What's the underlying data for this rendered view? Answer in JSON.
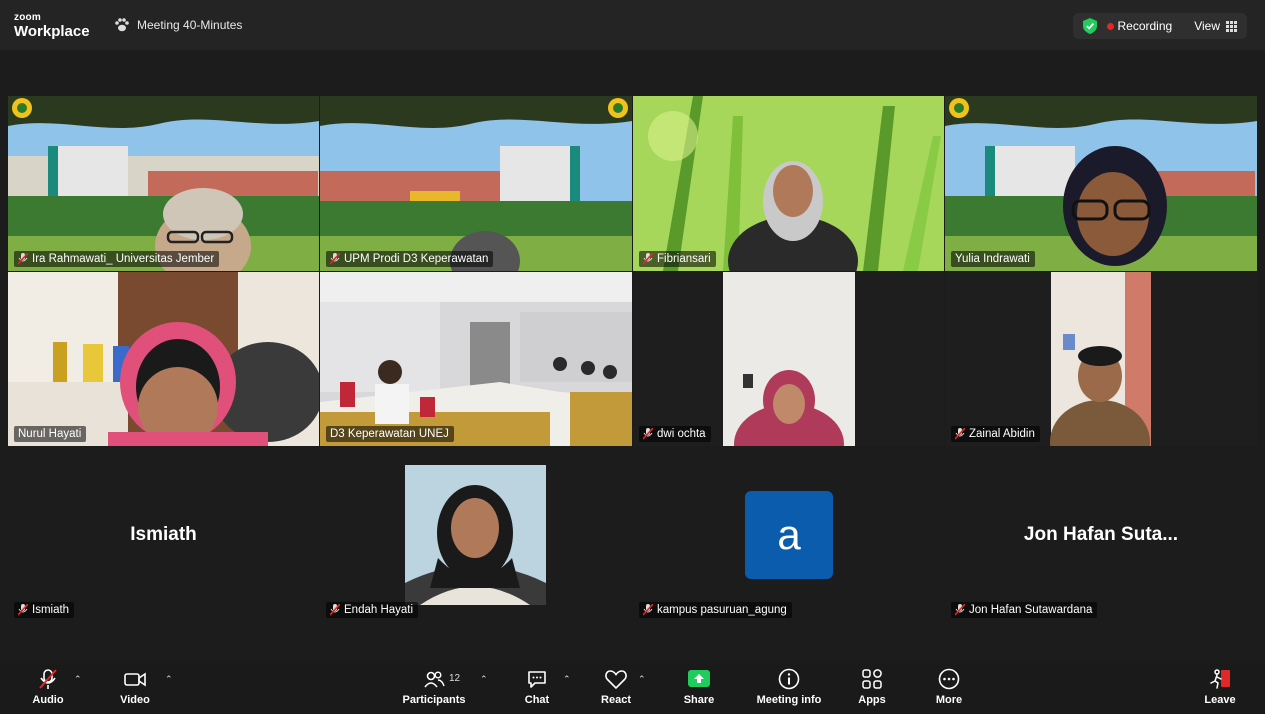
{
  "header": {
    "logo_top": "zoom",
    "logo_bottom": "Workplace",
    "meeting_title": "Meeting 40-Minutes",
    "recording_label": "Recording",
    "view_label": "View"
  },
  "participants": [
    {
      "name": "Ira Rahmawati_ Universitas Jember",
      "muted": true
    },
    {
      "name": "UPM Prodi D3 Keperawatan",
      "muted": true
    },
    {
      "name": "Fibriansari",
      "muted": true
    },
    {
      "name": "Yulia Indrawati",
      "muted": false,
      "active_speaker": true
    },
    {
      "name": "Nurul Hayati",
      "muted": false
    },
    {
      "name": "D3 Keperawatan UNEJ",
      "muted": false
    },
    {
      "name": "dwi ochta",
      "muted": true
    },
    {
      "name": "Zainal Abidin",
      "muted": true
    },
    {
      "name": "Ismiath",
      "muted": true,
      "display_name": "Ismiath"
    },
    {
      "name": "Endah Hayati",
      "muted": true
    },
    {
      "name": "kampus pasuruan_agung",
      "muted": true,
      "avatar_letter": "a"
    },
    {
      "name": "Jon Hafan Sutawardana",
      "muted": true,
      "display_name": "Jon Hafan Suta..."
    }
  ],
  "toolbar": {
    "audio": "Audio",
    "video": "Video",
    "participants": "Participants",
    "participants_count": "12",
    "chat": "Chat",
    "react": "React",
    "share": "Share",
    "meeting_info": "Meeting info",
    "apps": "Apps",
    "more": "More",
    "leave": "Leave"
  },
  "colors": {
    "active_speaker": "#3de07a",
    "share_green": "#1fcc5c",
    "recording_red": "#e02828",
    "avatar_blue": "#0b5cad"
  }
}
